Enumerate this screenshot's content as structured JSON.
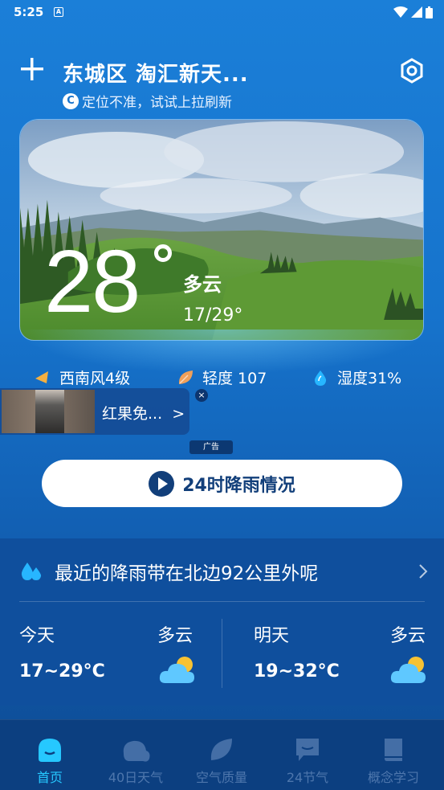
{
  "status_bar": {
    "time": "5:25",
    "notif_badge": "A"
  },
  "header": {
    "location": "东城区 淘汇新天...",
    "hint_icon": "C",
    "hint": "定位不准，试试上拉刷新"
  },
  "current": {
    "temperature": "28",
    "condition": "多云",
    "range": "17/29°"
  },
  "metrics": {
    "wind": "西南风4级",
    "air": "轻度 107",
    "humidity": "湿度31%"
  },
  "ad": {
    "text": "红果免...",
    "arrow": ">",
    "close": "×",
    "tag": "广告"
  },
  "rain_button": {
    "label": "24时降雨情况"
  },
  "alert": {
    "text": "最近的降雨带在北边92公里外呢"
  },
  "forecast": [
    {
      "day": "今天",
      "condition": "多云",
      "temp": "17~29°C"
    },
    {
      "day": "明天",
      "condition": "多云",
      "temp": "19~32°C"
    }
  ],
  "nav": [
    {
      "label": "首页",
      "active": true
    },
    {
      "label": "40日天气",
      "active": false
    },
    {
      "label": "空气质量",
      "active": false
    },
    {
      "label": "24节气",
      "active": false
    },
    {
      "label": "概念学习",
      "active": false
    }
  ],
  "colors": {
    "accent": "#26c8ff",
    "wind_icon": "#f5b041",
    "air_icon": "#f0a05a",
    "humidity_icon": "#27b6ff"
  }
}
